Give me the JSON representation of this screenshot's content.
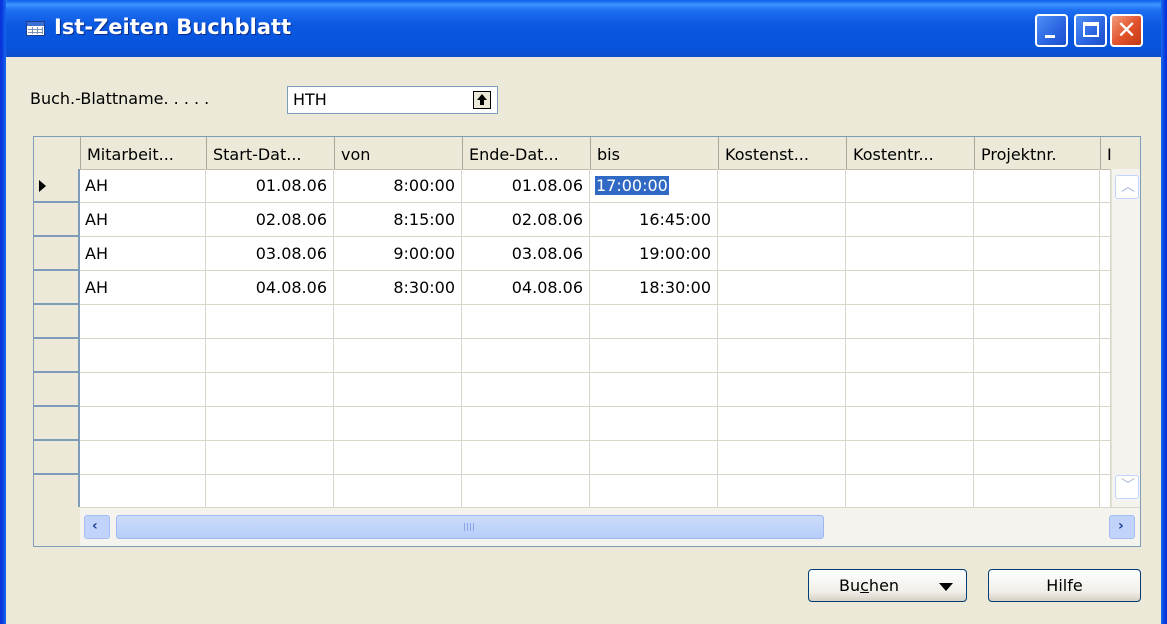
{
  "window": {
    "title": "Ist-Zeiten Buchblatt",
    "icon": "table-window-icon",
    "controls": [
      "minimize-icon",
      "maximize-icon",
      "close-icon"
    ]
  },
  "batch": {
    "label": "Buch.-Blattname. . . . .",
    "value": "HTH",
    "lookup_icon": "lookup-arrow-icon"
  },
  "grid": {
    "columns": [
      "Mitarbeit...",
      "Start-Dat...",
      "von",
      "Ende-Dat...",
      "bis",
      "Kostenst...",
      "Kostentr...",
      "Projektnr.",
      "I"
    ],
    "rows": [
      {
        "employee": "AH",
        "start_date": "01.08.06",
        "from": "8:00:00",
        "end_date": "01.08.06",
        "to": "17:00:00"
      },
      {
        "employee": "AH",
        "start_date": "02.08.06",
        "from": "8:15:00",
        "end_date": "02.08.06",
        "to": "16:45:00"
      },
      {
        "employee": "AH",
        "start_date": "03.08.06",
        "from": "9:00:00",
        "end_date": "03.08.06",
        "to": "19:00:00"
      },
      {
        "employee": "AH",
        "start_date": "04.08.06",
        "from": "8:30:00",
        "end_date": "04.08.06",
        "to": "18:30:00"
      }
    ],
    "selected_row": 0,
    "selected_cell": "bis",
    "selection_color": "#316ac5"
  },
  "buttons": {
    "post_prefix": "Bu",
    "post_underlined": "c",
    "post_suffix": "hen",
    "help": "Hilfe"
  },
  "colors": {
    "titlebar": "#0a58e0",
    "window_bg": "#ece9d8",
    "close_button": "#e0502a"
  }
}
